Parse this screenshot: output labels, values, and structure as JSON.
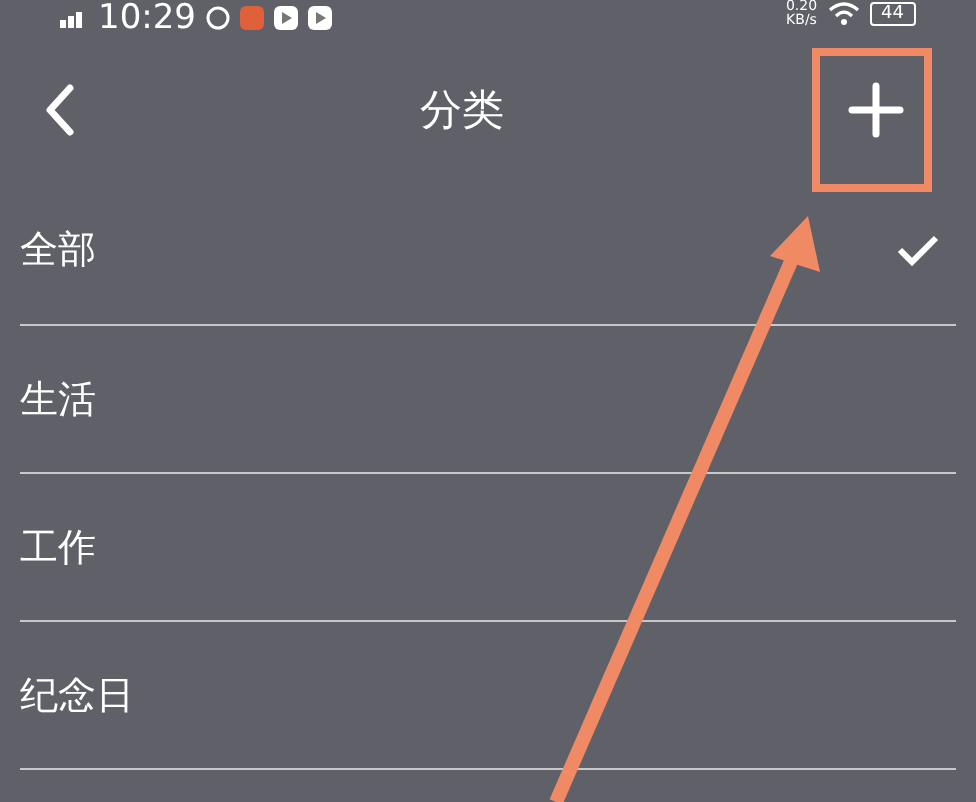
{
  "status_bar": {
    "time": "10:29",
    "network_speed": "0.20",
    "speed_unit": "KB/s",
    "battery": "44"
  },
  "header": {
    "title": "分类"
  },
  "categories": [
    {
      "label": "全部",
      "selected": true
    },
    {
      "label": "生活",
      "selected": false
    },
    {
      "label": "工作",
      "selected": false
    },
    {
      "label": "纪念日",
      "selected": false
    }
  ]
}
